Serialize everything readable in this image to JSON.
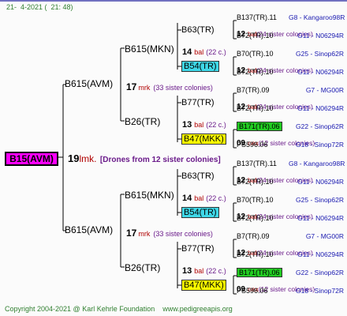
{
  "header": {
    "date": "21-  4-2021 (  21: 48)"
  },
  "footer": {
    "copyright": "Copyright 2004-2021 @ Karl Kehrle Foundation    www.pedigreeapis.org"
  },
  "root": {
    "name": "B15(AVM)",
    "gen": "19",
    "mark": "lmk.",
    "note": "[Drones from 12 sister colonies]"
  },
  "gen1": [
    {
      "name": "B615(AVM)",
      "gen": "17",
      "mark": "mrk",
      "note": "(33 sister colonies)"
    },
    {
      "name": "B615(AVM)",
      "gen": "17",
      "mark": "mrk",
      "note": "(33 sister colonies)"
    }
  ],
  "gen2": [
    {
      "name": "B615(MKN)",
      "gen": "14",
      "mark": "bal",
      "note": "(22 c.)"
    },
    {
      "name": "B26(TR)",
      "gen": "13",
      "mark": "bal",
      "note": "(22 c.)"
    },
    {
      "name": "B615(MKN)",
      "gen": "14",
      "mark": "bal",
      "note": "(22 c.)"
    },
    {
      "name": "B26(TR)",
      "gen": "13",
      "mark": "bal",
      "note": "(22 c.)"
    }
  ],
  "gen3": [
    {
      "name": "B63(TR)"
    },
    {
      "name": "B54(TR)",
      "color": "#3fd8e8"
    },
    {
      "name": "B77(TR)"
    },
    {
      "name": "B47(MKK)",
      "color": "#ffff00"
    },
    {
      "name": "B63(TR)"
    },
    {
      "name": "B54(TR)",
      "color": "#3fd8e8"
    },
    {
      "name": "B77(TR)"
    },
    {
      "name": "B47(MKK)",
      "color": "#ffff00"
    }
  ],
  "gen3_detail": [
    {
      "gen": "12",
      "mark": "bal",
      "note": "(24 sister colonies)"
    },
    {
      "gen": "12",
      "mark": "bal",
      "note": "(24 sister colonies)"
    },
    {
      "gen": "12",
      "mark": "bal",
      "note": "(24 sister colonies)"
    },
    {
      "gen": "09",
      "mark": "nex",
      "note": "(12 sister colonies)"
    },
    {
      "gen": "12",
      "mark": "bal",
      "note": "(24 sister colonies)"
    },
    {
      "gen": "12",
      "mark": "bal",
      "note": "(24 sister colonies)"
    },
    {
      "gen": "12",
      "mark": "bal",
      "note": "(24 sister colonies)"
    },
    {
      "gen": "09",
      "mark": "nex",
      "note": "(12 sister colonies)"
    }
  ],
  "gen4": [
    {
      "name": "B137(TR).11",
      "code": "G8 - Kangaroo98R"
    },
    {
      "name": "B72(TR).10",
      "code": "G11 - N06294R"
    },
    {
      "name": "B70(TR).10",
      "code": "G25 - Sinop62R"
    },
    {
      "name": "B72(TR).10",
      "code": "G11 - N06294R"
    },
    {
      "name": "B7(TR).09",
      "code": "G7 - MG00R"
    },
    {
      "name": "B72(TR).10",
      "code": "G11 - N06294R"
    },
    {
      "name": "B171(TR).06",
      "code": "G22 - Sinop62R",
      "color": "#22cc22"
    },
    {
      "name": "PS596.06",
      "code": "G18 - Sinop72R"
    },
    {
      "name": "B137(TR).11",
      "code": "G8 - Kangaroo98R"
    },
    {
      "name": "B72(TR).10",
      "code": "G11 - N06294R"
    },
    {
      "name": "B70(TR).10",
      "code": "G25 - Sinop62R"
    },
    {
      "name": "B72(TR).10",
      "code": "G11 - N06294R"
    },
    {
      "name": "B7(TR).09",
      "code": "G7 - MG00R"
    },
    {
      "name": "B72(TR).10",
      "code": "G11 - N06294R"
    },
    {
      "name": "B171(TR).06",
      "code": "G22 - Sinop62R",
      "color": "#22cc22"
    },
    {
      "name": "PS596.06",
      "code": "G18 - Sinop72R"
    }
  ]
}
